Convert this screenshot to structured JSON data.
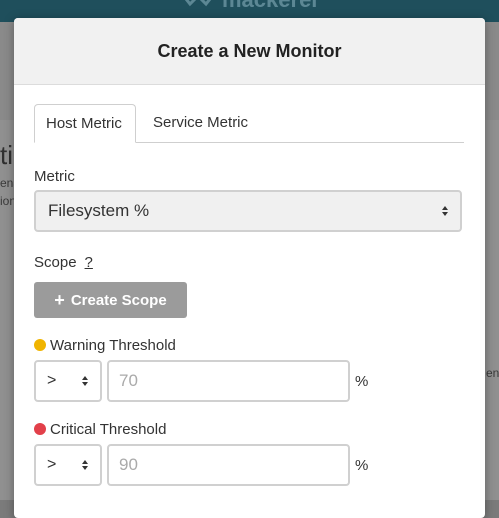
{
  "background": {
    "logo_text": "mackerel",
    "fragments": [
      "ti",
      "ena",
      "ion",
      "en"
    ]
  },
  "modal": {
    "title": "Create a New Monitor",
    "tabs": [
      {
        "label": "Host Metric",
        "active": true
      },
      {
        "label": "Service Metric",
        "active": false
      }
    ],
    "metric": {
      "label": "Metric",
      "selected": "Filesystem %"
    },
    "scope": {
      "label": "Scope",
      "help": "?",
      "button_label": "Create Scope",
      "button_icon": "plus-icon"
    },
    "warning": {
      "label": "Warning Threshold",
      "color": "#f0b400",
      "operator": ">",
      "placeholder": "70",
      "unit": "%"
    },
    "critical": {
      "label": "Critical Threshold",
      "color": "#e2404a",
      "operator": ">",
      "placeholder": "90",
      "unit": "%"
    }
  }
}
